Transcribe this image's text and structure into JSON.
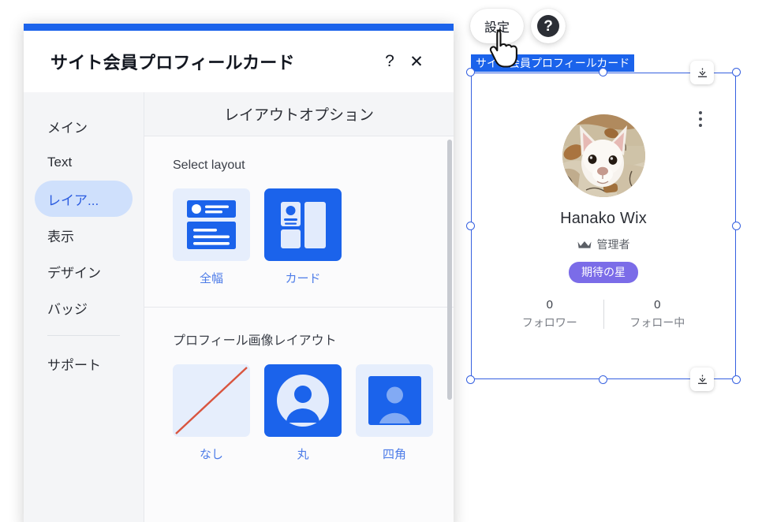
{
  "canvas": {
    "toolbar": {
      "settings_label": "設定",
      "help_icon": "question-mark-icon",
      "help_label": "?"
    },
    "selection": {
      "label": "サイト会員プロフィールカード",
      "stretch_icon": "stretch-to-width-icon"
    },
    "profile": {
      "avatar_alt": "dog-photo",
      "name": "Hanako Wix",
      "role_icon": "crown-icon",
      "role": "管理者",
      "badge": "期待の星",
      "stats": [
        {
          "value": "0",
          "label": "フォロワー"
        },
        {
          "value": "0",
          "label": "フォロー中"
        }
      ],
      "menu_icon": "kebab-menu-icon"
    }
  },
  "dialog": {
    "title": "サイト会員プロフィールカード",
    "help_label": "?",
    "close_label": "✕",
    "sidebar": {
      "items": [
        {
          "label": "メイン",
          "selected": false
        },
        {
          "label": "Text",
          "selected": false
        },
        {
          "label": "レイア...",
          "selected": true
        },
        {
          "label": "表示",
          "selected": false
        },
        {
          "label": "デザイン",
          "selected": false
        },
        {
          "label": "バッジ",
          "selected": false
        }
      ],
      "support": {
        "label": "サポート"
      }
    },
    "content": {
      "header": "レイアウトオプション",
      "sections": [
        {
          "title": "Select layout",
          "options": [
            {
              "label": "全幅",
              "selected": false,
              "thumb": "full-width-layout-thumb"
            },
            {
              "label": "カード",
              "selected": true,
              "thumb": "card-layout-thumb"
            }
          ]
        },
        {
          "title": "プロフィール画像レイアウト",
          "options": [
            {
              "label": "なし",
              "selected": false,
              "thumb": "no-image-thumb"
            },
            {
              "label": "丸",
              "selected": true,
              "thumb": "circle-image-thumb"
            },
            {
              "label": "四角",
              "selected": false,
              "thumb": "square-image-thumb"
            }
          ]
        }
      ]
    }
  },
  "colors": {
    "brand_blue": "#1b63eb",
    "selection_blue": "#3560e0",
    "sidebar_selected_bg": "#cfe0fc",
    "link_blue": "#4d7ce8",
    "badge_purple": "#7b6ce8"
  }
}
